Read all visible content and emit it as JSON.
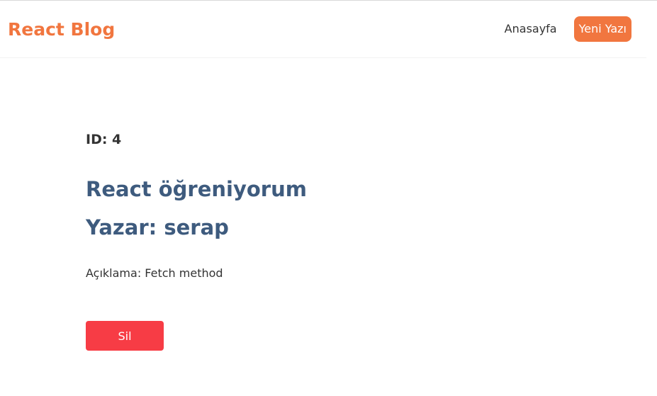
{
  "navbar": {
    "brand": "React Blog",
    "links": {
      "home": "Anasayfa",
      "new_post": "Yeni Yazı"
    }
  },
  "post": {
    "id_text": "ID: 4",
    "title": "React öğreniyorum",
    "author_text": "Yazar: serap",
    "description_text": "Açıklama: Fetch method",
    "delete_label": "Sil"
  },
  "colors": {
    "brand": "#f1763f",
    "heading": "#3e5b7e",
    "delete": "#f73c45"
  }
}
